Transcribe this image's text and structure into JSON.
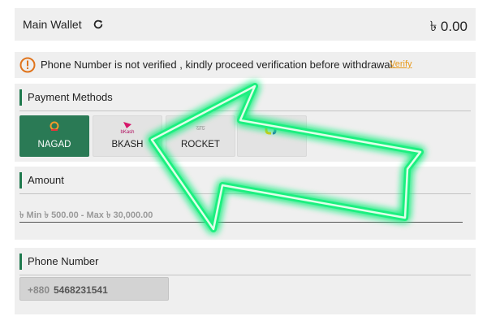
{
  "wallet": {
    "label": "Main Wallet",
    "balance": "৳ 0.00"
  },
  "warning": {
    "message": "Phone Number is not verified , kindly proceed verification before withdrawal.",
    "link": "Verify"
  },
  "payment": {
    "title": "Payment Methods",
    "methods": [
      {
        "label": "NAGAD",
        "selected": true,
        "logo_icon": "nagad-logo-icon"
      },
      {
        "label": "BKASH",
        "selected": false,
        "logo_icon": "bkash-logo-icon",
        "logo_text": "bKash"
      },
      {
        "label": "ROCKET",
        "selected": false,
        "logo_icon": "rocket-logo-icon",
        "logo_text": "ডাচ"
      },
      {
        "label": "",
        "selected": false,
        "logo_icon": "upay-logo-icon"
      }
    ]
  },
  "amount": {
    "title": "Amount",
    "range": "৳ Min ৳ 500.00 - Max ৳ 30,000.00"
  },
  "phone": {
    "title": "Phone Number",
    "prefix": "+880",
    "value": "5468231541"
  },
  "colors": {
    "accent": "#1f7a4e",
    "selected": "#2a7a55",
    "warning": "#e0741c",
    "arrow": "#2bff8a"
  }
}
